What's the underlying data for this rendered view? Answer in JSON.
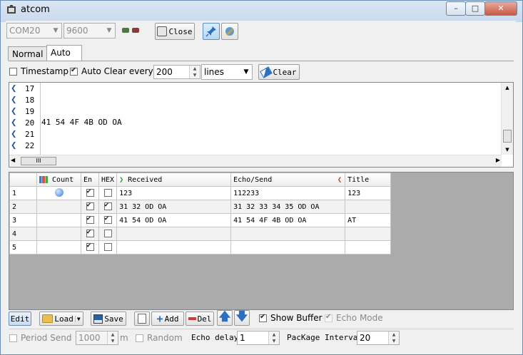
{
  "window": {
    "title": "atcom",
    "min_icon": "minimize-icon",
    "max_icon": "maximize-icon",
    "close_icon": "close-icon"
  },
  "toolbar": {
    "port_value": "COM20",
    "baud_value": "9600",
    "close_label": "Close",
    "pin_icon": "pin-icon",
    "settings_icon": "settings-icon"
  },
  "tabs": [
    {
      "label": "Normal"
    },
    {
      "label": "Auto"
    }
  ],
  "options": {
    "timestamp_label": "Timestamp",
    "timestamp_checked": false,
    "autoclear_label": "Auto Clear every",
    "autoclear_checked": true,
    "autoclear_value": "200",
    "unit_value": "lines",
    "clear_label": "Clear"
  },
  "log": {
    "lines": [
      {
        "num": "17",
        "text": ""
      },
      {
        "num": "18",
        "text": ""
      },
      {
        "num": "19",
        "text": ""
      },
      {
        "num": "20",
        "text": "41 54 4F 4B OD OA"
      },
      {
        "num": "21",
        "text": ""
      },
      {
        "num": "22",
        "text": ""
      }
    ],
    "hscroll_thumb": "III"
  },
  "grid": {
    "headers": {
      "count": "Count",
      "en": "En",
      "hex": "HEX",
      "received": "Received",
      "echo": "Echo/Send",
      "title": "Title"
    },
    "rows": [
      {
        "idx": "1",
        "en": true,
        "hex": false,
        "received": "123",
        "echo": "112233",
        "title": "123",
        "active": true
      },
      {
        "idx": "2",
        "en": true,
        "hex": true,
        "received": "31 32 OD OA",
        "echo": "31 32 33 34 35 OD OA",
        "title": ""
      },
      {
        "idx": "3",
        "en": true,
        "hex": true,
        "received": "41 54 OD OA",
        "echo": "41 54 4F 4B OD OA",
        "title": "AT"
      },
      {
        "idx": "4",
        "en": true,
        "hex": false,
        "received": "",
        "echo": "",
        "title": ""
      },
      {
        "idx": "5",
        "en": true,
        "hex": false,
        "received": "",
        "echo": "",
        "title": ""
      }
    ]
  },
  "bottom": {
    "edit_label": "Edit",
    "load_label": "Load",
    "save_label": "Save",
    "add_label": "Add",
    "del_label": "Del",
    "show_buffer_label": "Show Buffer",
    "show_buffer_checked": true,
    "echo_mode_label": "Echo Mode",
    "echo_mode_checked": true
  },
  "status": {
    "period_send_label": "Period Send",
    "period_value": "1000",
    "ms_label": "ms",
    "random_label": "Random",
    "echo_delay_label": "Echo delay",
    "echo_delay_value": "1",
    "package_interval_label": "PacKage Interval",
    "package_interval_value": "20"
  },
  "colors": {
    "accent": "#1e5aa8",
    "received_arrow": "#2e9a2e",
    "echo_arrow": "#c0392b"
  }
}
